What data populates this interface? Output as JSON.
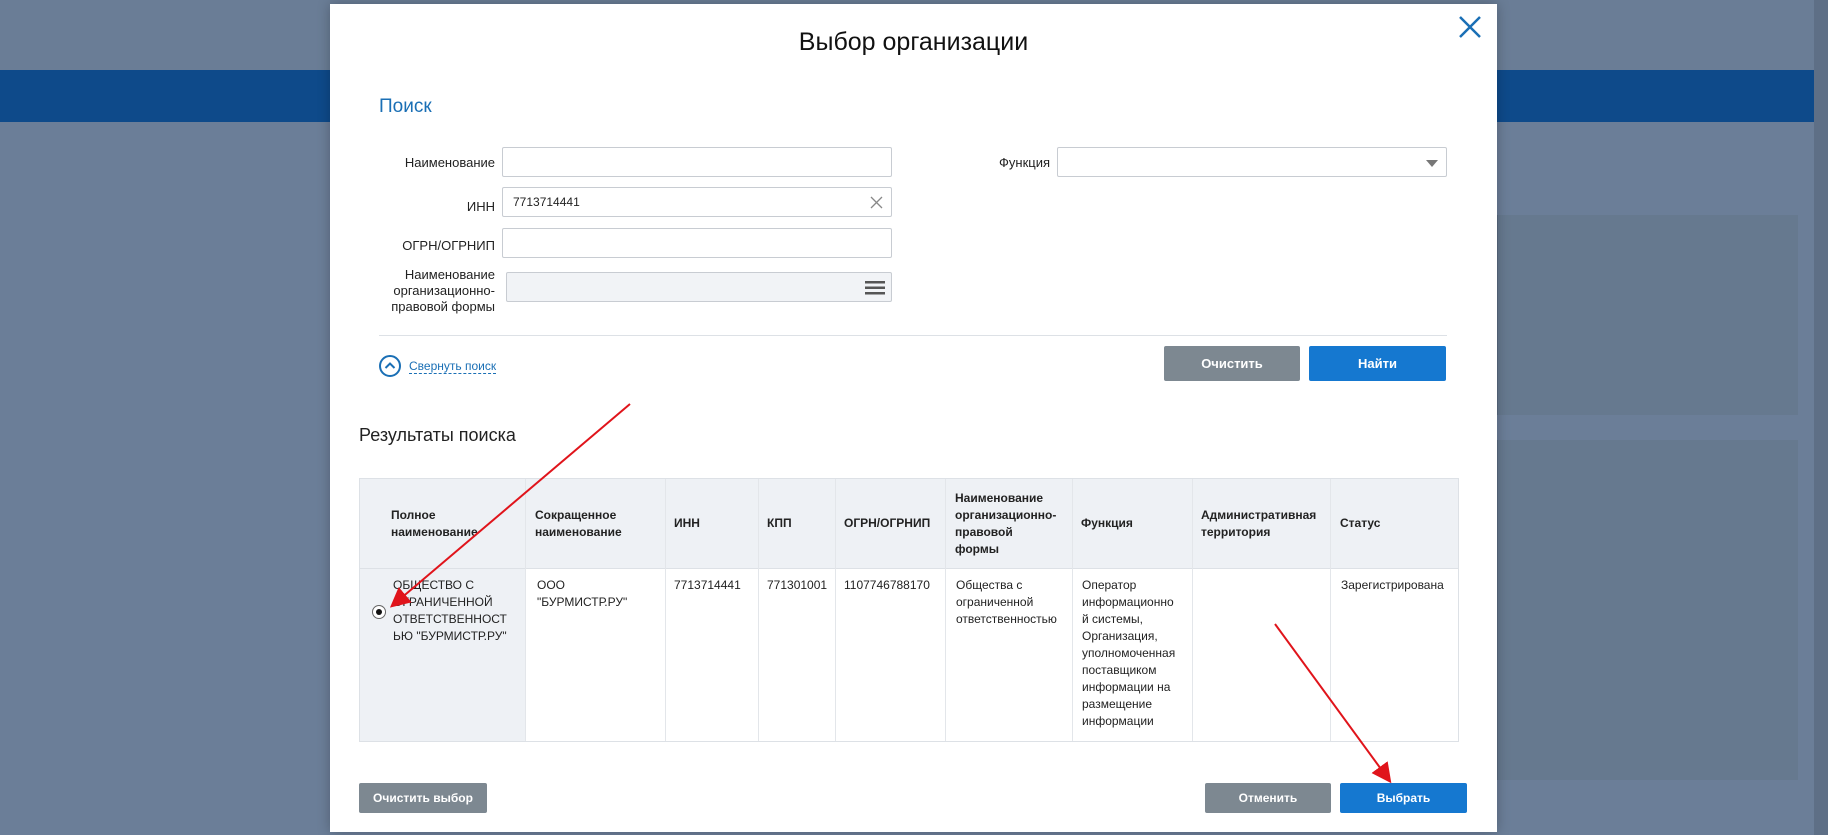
{
  "dialog": {
    "title": "Выбор организации",
    "search_title": "Поиск",
    "fields": {
      "name_label": "Наименование",
      "name_value": "",
      "inn_label": "ИНН",
      "inn_value": "7713714441",
      "ogrn_label": "ОГРН/ОГРНИП",
      "ogrn_value": "",
      "opf_label_1": "Наименование",
      "opf_label_2": "организационно-",
      "opf_label_3": "правовой формы",
      "opf_value": "",
      "function_label": "Функция",
      "function_value": ""
    },
    "collapse_link": "Свернуть поиск",
    "buttons": {
      "clear": "Очистить",
      "find": "Найти",
      "clear_selection": "Очистить выбор",
      "cancel": "Отменить",
      "select": "Выбрать"
    },
    "results_title": "Результаты поиска"
  },
  "table": {
    "headers": {
      "full_name_1": "Полное",
      "full_name_2": "наименование",
      "short_name_1": "Сокращенное",
      "short_name_2": "наименование",
      "inn": "ИНН",
      "kpp": "КПП",
      "ogrn": "ОГРН/ОГРНИП",
      "opf_1": "Наименование",
      "opf_2": "организационно-",
      "opf_3": "правовой",
      "opf_4": "формы",
      "function": "Функция",
      "admin_1": "Административная",
      "admin_2": "территория",
      "status": "Статус"
    },
    "row": {
      "selected": true,
      "full_name_1": "ОБЩЕСТВО С",
      "full_name_2": "ОГРАНИЧЕННОЙ",
      "full_name_3": "ОТВЕТСТВЕННОСТ",
      "full_name_4": "ЬЮ \"БУРМИСТР.РУ\"",
      "short_name_1": "ООО",
      "short_name_2": "\"БУРМИСТР.РУ\"",
      "inn": "7713714441",
      "kpp": "771301001",
      "ogrn": "1107746788170",
      "opf_1": "Общества с",
      "opf_2": "ограниченной",
      "opf_3": "ответственностью",
      "function_1": "Оператор",
      "function_2": "информационно",
      "function_3": "й системы,",
      "function_4": "Организация,",
      "function_5": "уполномоченная",
      "function_6": "поставщиком",
      "function_7": "информации на",
      "function_8": "размещение",
      "function_9": "информации",
      "admin": "",
      "status": "Зарегистрирована"
    }
  },
  "colors": {
    "accent_blue": "#1578d0",
    "link_blue": "#1a6fb5",
    "gray_button": "#7d8891",
    "annotation_arrow": "#e0141b"
  },
  "icons": [
    "close-icon",
    "clear-x-icon",
    "list-icon",
    "dropdown-arrow-icon",
    "chevron-up-icon"
  ]
}
